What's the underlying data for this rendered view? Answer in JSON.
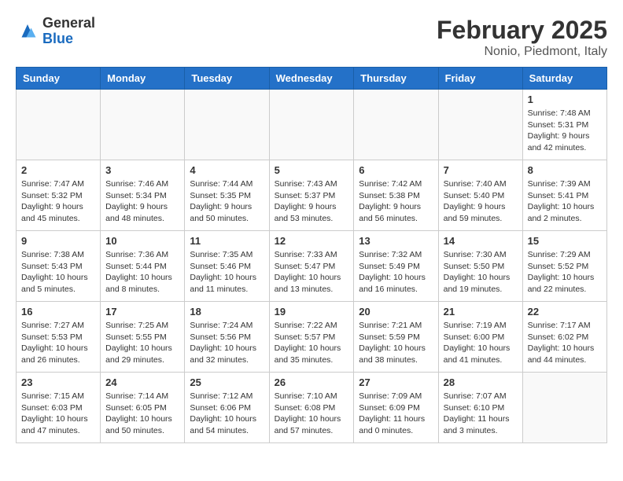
{
  "header": {
    "logo_general": "General",
    "logo_blue": "Blue",
    "month_title": "February 2025",
    "location": "Nonio, Piedmont, Italy"
  },
  "weekdays": [
    "Sunday",
    "Monday",
    "Tuesday",
    "Wednesday",
    "Thursday",
    "Friday",
    "Saturday"
  ],
  "weeks": [
    [
      {
        "day": "",
        "info": ""
      },
      {
        "day": "",
        "info": ""
      },
      {
        "day": "",
        "info": ""
      },
      {
        "day": "",
        "info": ""
      },
      {
        "day": "",
        "info": ""
      },
      {
        "day": "",
        "info": ""
      },
      {
        "day": "1",
        "info": "Sunrise: 7:48 AM\nSunset: 5:31 PM\nDaylight: 9 hours and 42 minutes."
      }
    ],
    [
      {
        "day": "2",
        "info": "Sunrise: 7:47 AM\nSunset: 5:32 PM\nDaylight: 9 hours and 45 minutes."
      },
      {
        "day": "3",
        "info": "Sunrise: 7:46 AM\nSunset: 5:34 PM\nDaylight: 9 hours and 48 minutes."
      },
      {
        "day": "4",
        "info": "Sunrise: 7:44 AM\nSunset: 5:35 PM\nDaylight: 9 hours and 50 minutes."
      },
      {
        "day": "5",
        "info": "Sunrise: 7:43 AM\nSunset: 5:37 PM\nDaylight: 9 hours and 53 minutes."
      },
      {
        "day": "6",
        "info": "Sunrise: 7:42 AM\nSunset: 5:38 PM\nDaylight: 9 hours and 56 minutes."
      },
      {
        "day": "7",
        "info": "Sunrise: 7:40 AM\nSunset: 5:40 PM\nDaylight: 9 hours and 59 minutes."
      },
      {
        "day": "8",
        "info": "Sunrise: 7:39 AM\nSunset: 5:41 PM\nDaylight: 10 hours and 2 minutes."
      }
    ],
    [
      {
        "day": "9",
        "info": "Sunrise: 7:38 AM\nSunset: 5:43 PM\nDaylight: 10 hours and 5 minutes."
      },
      {
        "day": "10",
        "info": "Sunrise: 7:36 AM\nSunset: 5:44 PM\nDaylight: 10 hours and 8 minutes."
      },
      {
        "day": "11",
        "info": "Sunrise: 7:35 AM\nSunset: 5:46 PM\nDaylight: 10 hours and 11 minutes."
      },
      {
        "day": "12",
        "info": "Sunrise: 7:33 AM\nSunset: 5:47 PM\nDaylight: 10 hours and 13 minutes."
      },
      {
        "day": "13",
        "info": "Sunrise: 7:32 AM\nSunset: 5:49 PM\nDaylight: 10 hours and 16 minutes."
      },
      {
        "day": "14",
        "info": "Sunrise: 7:30 AM\nSunset: 5:50 PM\nDaylight: 10 hours and 19 minutes."
      },
      {
        "day": "15",
        "info": "Sunrise: 7:29 AM\nSunset: 5:52 PM\nDaylight: 10 hours and 22 minutes."
      }
    ],
    [
      {
        "day": "16",
        "info": "Sunrise: 7:27 AM\nSunset: 5:53 PM\nDaylight: 10 hours and 26 minutes."
      },
      {
        "day": "17",
        "info": "Sunrise: 7:25 AM\nSunset: 5:55 PM\nDaylight: 10 hours and 29 minutes."
      },
      {
        "day": "18",
        "info": "Sunrise: 7:24 AM\nSunset: 5:56 PM\nDaylight: 10 hours and 32 minutes."
      },
      {
        "day": "19",
        "info": "Sunrise: 7:22 AM\nSunset: 5:57 PM\nDaylight: 10 hours and 35 minutes."
      },
      {
        "day": "20",
        "info": "Sunrise: 7:21 AM\nSunset: 5:59 PM\nDaylight: 10 hours and 38 minutes."
      },
      {
        "day": "21",
        "info": "Sunrise: 7:19 AM\nSunset: 6:00 PM\nDaylight: 10 hours and 41 minutes."
      },
      {
        "day": "22",
        "info": "Sunrise: 7:17 AM\nSunset: 6:02 PM\nDaylight: 10 hours and 44 minutes."
      }
    ],
    [
      {
        "day": "23",
        "info": "Sunrise: 7:15 AM\nSunset: 6:03 PM\nDaylight: 10 hours and 47 minutes."
      },
      {
        "day": "24",
        "info": "Sunrise: 7:14 AM\nSunset: 6:05 PM\nDaylight: 10 hours and 50 minutes."
      },
      {
        "day": "25",
        "info": "Sunrise: 7:12 AM\nSunset: 6:06 PM\nDaylight: 10 hours and 54 minutes."
      },
      {
        "day": "26",
        "info": "Sunrise: 7:10 AM\nSunset: 6:08 PM\nDaylight: 10 hours and 57 minutes."
      },
      {
        "day": "27",
        "info": "Sunrise: 7:09 AM\nSunset: 6:09 PM\nDaylight: 11 hours and 0 minutes."
      },
      {
        "day": "28",
        "info": "Sunrise: 7:07 AM\nSunset: 6:10 PM\nDaylight: 11 hours and 3 minutes."
      },
      {
        "day": "",
        "info": ""
      }
    ]
  ]
}
